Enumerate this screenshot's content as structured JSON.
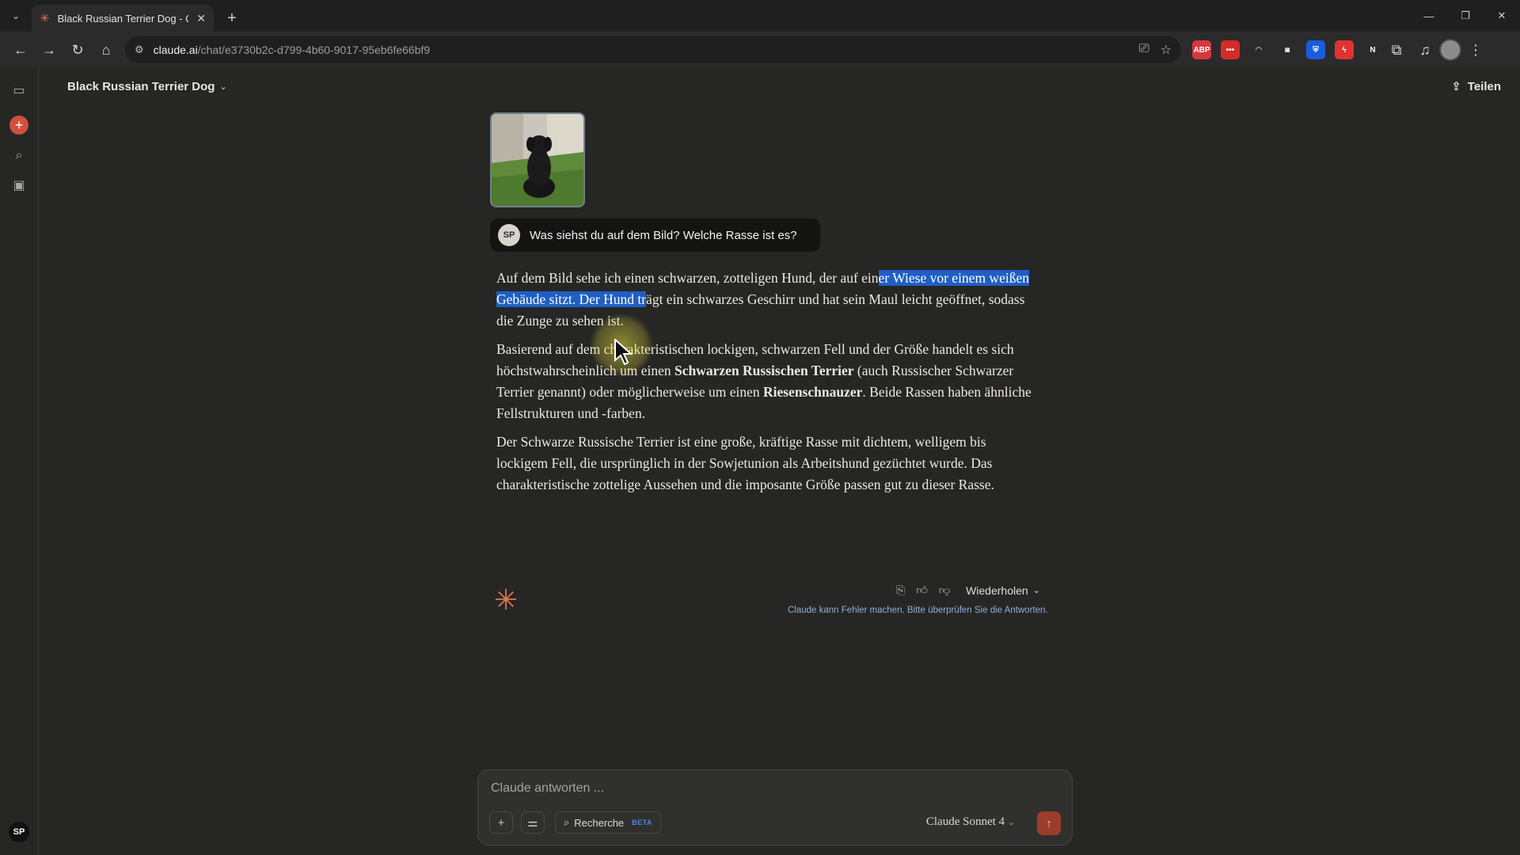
{
  "browser": {
    "tab_title": "Black Russian Terrier Dog - Clau",
    "url_host": "claude.ai",
    "url_path": "/chat/e3730b2c-d799-4b60-9017-95eb6fe66bf9",
    "extensions": [
      {
        "name": "abp",
        "label": "ABP",
        "color": "#d9363e"
      },
      {
        "name": "lastpass",
        "label": "•••",
        "color": "#d32d27"
      },
      {
        "name": "rainbow",
        "label": "◠",
        "color": "#2b2b2b"
      },
      {
        "name": "camera",
        "label": "◙",
        "color": "#2b2b2b"
      },
      {
        "name": "bitwarden",
        "label": "⛨",
        "color": "#175ddc"
      },
      {
        "name": "flash",
        "label": "ϟ",
        "color": "#e0332f"
      },
      {
        "name": "notion",
        "label": "N",
        "color": "#2b2b2b"
      }
    ]
  },
  "app": {
    "chat_title": "Black Russian Terrier Dog",
    "share_label": "Teilen",
    "user_initials": "SP",
    "user_message": "Was siehst du auf dem Bild? Welche Rasse ist es?",
    "answer": {
      "p1_a": "Auf dem Bild sehe ich einen schwarzen, zotteligen Hund, der auf ein",
      "p1_hl": "er Wiese vor einem weißen Gebäude sitzt. Der Hund tr",
      "p1_b": "ägt ein schwarzes Geschirr und hat sein Maul leicht geöffnet, sodass die Zunge zu sehen ist.",
      "p2_a": "Basierend auf dem charakteristischen lockigen, schwarzen Fell und der Größe handelt es sich höchstwahrscheinlich um einen ",
      "p2_b1": "Schwarzen Russischen Terrier",
      "p2_c": " (auch Russischer Schwarzer Terrier genannt) oder möglicherweise um einen ",
      "p2_b2": "Riesenschnauzer",
      "p2_d": ". Beide Rassen haben ähnliche Fellstrukturen und -farben.",
      "p3": "Der Schwarze Russische Terrier ist eine große, kräftige Rasse mit dichtem, welligem bis lockigem Fell, die ursprünglich in der Sowjetunion als Arbeitshund gezüchtet wurde. Das charakteristische zottelige Aussehen und die imposante Größe passen gut zu dieser Rasse."
    },
    "retry_label": "Wiederholen",
    "disclaimer": "Claude kann Fehler machen. Bitte überprüfen Sie die Antworten.",
    "composer": {
      "placeholder": "Claude antworten ...",
      "research_label": "Recherche",
      "beta_label": "BETA",
      "model_label": "Claude Sonnet 4"
    }
  }
}
